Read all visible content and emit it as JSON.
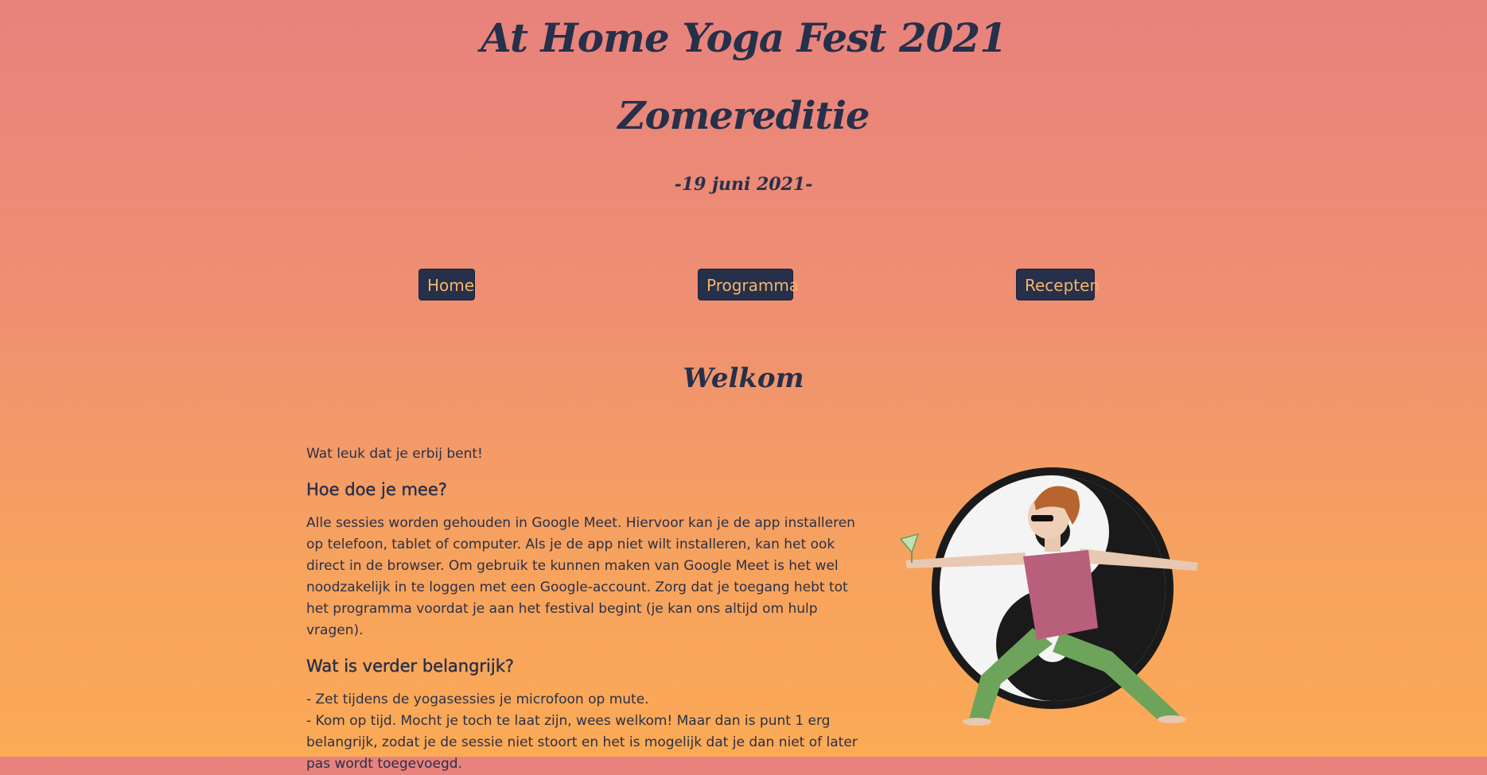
{
  "header": {
    "title": "At Home Yoga Fest 2021",
    "subtitle": "Zomereditie",
    "date": "-19 juni 2021-"
  },
  "nav": {
    "home": "Home",
    "programma": "Programma",
    "recepten": "Recepten"
  },
  "main": {
    "heading": "Welkom",
    "intro": "Wat leuk dat je erbij bent!",
    "section1_title": "Hoe doe je mee?",
    "section1_text": "Alle sessies worden gehouden in Google Meet. Hiervoor kan je de app installeren op telefoon, tablet of computer. Als je de app niet wilt installeren, kan het ook direct in de browser. Om gebruik te kunnen maken van Google Meet is het wel noodzakelijk in te loggen met een Google-account. Zorg dat je toegang hebt tot het programma voordat je aan het festival begint (je kan ons altijd om hulp vragen).",
    "section2_title": "Wat is verder belangrijk?",
    "section2_items": [
      "- Zet tijdens de yogasessies je microfoon op mute.",
      "- Kom op tijd. Mocht je toch te laat zijn, wees welkom! Maar dan is punt 1 erg belangrijk, zodat je de sessie niet stoort en het is mogelijk dat je dan niet of later pas wordt toegevoegd."
    ]
  },
  "illustration": {
    "icon": "yin-yang-yoga-icon"
  },
  "colors": {
    "text": "#26304a",
    "button_bg": "#26304a",
    "button_text": "#f6b46a",
    "gradient_top": "#e8827d",
    "gradient_bottom": "#fbaa55"
  }
}
